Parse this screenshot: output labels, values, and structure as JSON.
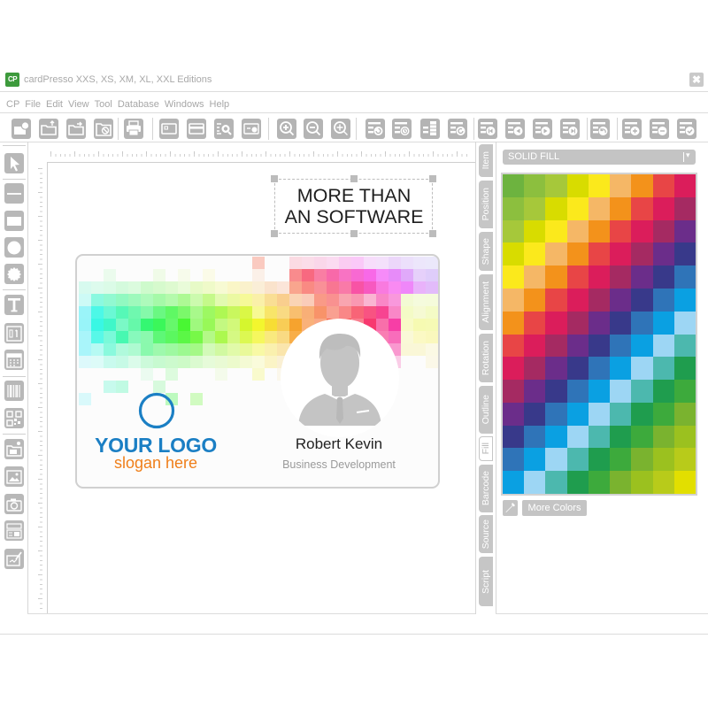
{
  "window": {
    "logo": "CP",
    "title": "cardPresso XXS, XS, XM, XL, XXL Editions",
    "close_icon": "close-icon",
    "close_glyph": "✖"
  },
  "menu": [
    "CP",
    "File",
    "Edit",
    "View",
    "Tool",
    "Database",
    "Windows",
    "Help"
  ],
  "toolbar": {
    "groups": [
      [
        "new-card",
        "open-card",
        "open-template",
        "close-card"
      ],
      [
        "print"
      ],
      [
        "card-front",
        "card-back",
        "card-preview",
        "card-settings"
      ],
      [
        "zoom-in",
        "zoom-out",
        "zoom-fit"
      ],
      [
        "db-refresh",
        "db-history",
        "db-table",
        "db-reload"
      ],
      [
        "db-first",
        "db-previous",
        "db-next",
        "db-last"
      ],
      [
        "db-undo"
      ],
      [
        "db-add-record",
        "db-remove-record",
        "db-apply"
      ]
    ]
  },
  "tools": {
    "groups": [
      [
        "select-tool"
      ],
      [
        "line-tool",
        "rectangle-tool",
        "ellipse-tool",
        "star-tool"
      ],
      [
        "text-tool",
        "field-tool",
        "date-tool"
      ],
      [
        "barcode-tool",
        "qrcode-tool"
      ],
      [
        "image-file-tool",
        "image-tool",
        "camera-tool",
        "photo-id-tool",
        "signature-tool"
      ]
    ]
  },
  "canvas": {
    "text_box": {
      "lines": [
        "MORE THAN",
        "AN SOFTWARE"
      ]
    },
    "card": {
      "logo_text": "YOUR LOGO",
      "slogan": "slogan here",
      "name": "Robert Kevin",
      "job_title": "Business Development",
      "colors": {
        "logo_blue": "#1b7fc4",
        "logo_orange": "#ef7f1a",
        "avatar_gray": "#c4c4c4"
      }
    }
  },
  "properties_panel": {
    "tabs": [
      {
        "label": "Item"
      },
      {
        "label": "Position"
      },
      {
        "label": "Shape"
      },
      {
        "label": "Alignment"
      },
      {
        "label": "Rotation"
      },
      {
        "label": "Outline"
      },
      {
        "label": "Fill"
      },
      {
        "label": "Barcode"
      },
      {
        "label": "Source"
      },
      {
        "label": "Script"
      }
    ],
    "active_tab": "Fill",
    "fill_type": "SOLID FILL",
    "dropdown_arrow": "▾",
    "palette": {
      "rows": 14,
      "columns": 9,
      "sequence": [
        "#6db33f",
        "#8cbf3e",
        "#a6c83a",
        "#d8dc00",
        "#fbe91c",
        "#f5b766",
        "#f3921b",
        "#e84546",
        "#db1d5b",
        "#a52a62",
        "#6b2d8a",
        "#38398a",
        "#2f74b8",
        "#0aa0e2",
        "#9dd6f4",
        "#4cb8ae",
        "#1f9d4e",
        "#3daa3c",
        "#7ab32f",
        "#9bc11f",
        "#b8cb1a",
        "#e2df00"
      ]
    },
    "eyedropper_icon": "eyedropper-icon",
    "more_colors_label": "More Colors"
  }
}
